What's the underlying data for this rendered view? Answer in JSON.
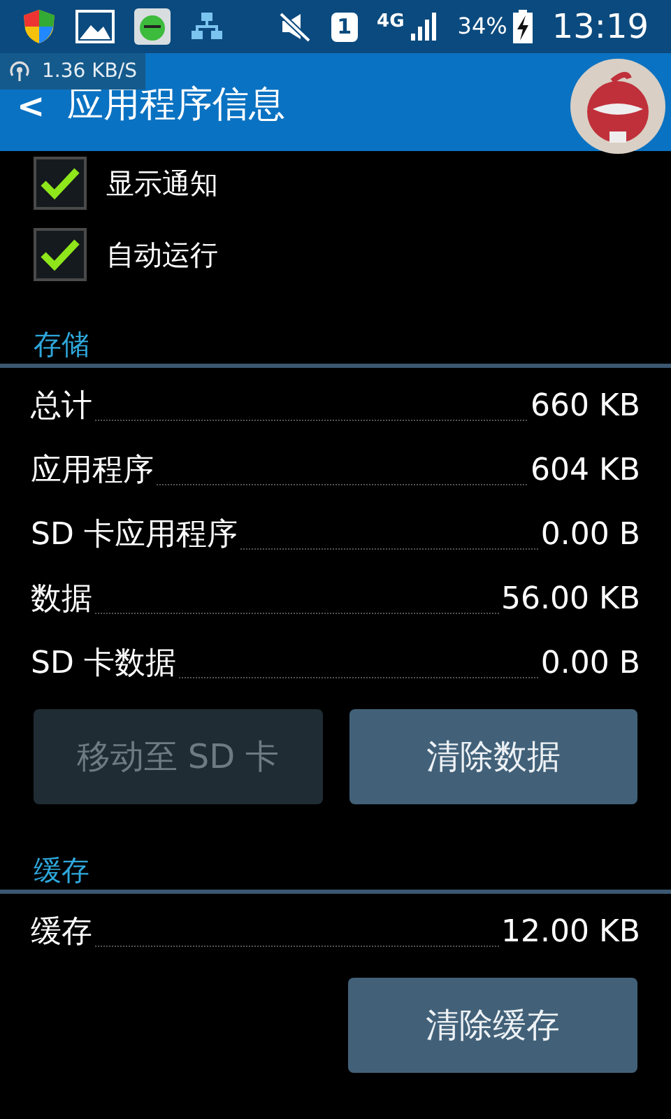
{
  "status_bar": {
    "sim": "1",
    "network": "4G",
    "battery": "34%",
    "time": "13:19"
  },
  "speed_overlay": "1.36 KB/S",
  "app_bar": {
    "back": "<",
    "title": "应用程序信息"
  },
  "options": [
    {
      "label": "显示通知",
      "checked": true
    },
    {
      "label": "自动运行",
      "checked": true
    }
  ],
  "sections": [
    {
      "title": "存储",
      "rows": [
        {
          "label": "总计",
          "value": "660 KB"
        },
        {
          "label": "应用程序",
          "value": "604 KB"
        },
        {
          "label": "SD 卡应用程序",
          "value": "0.00 B"
        },
        {
          "label": "数据",
          "value": "56.00 KB"
        },
        {
          "label": "SD 卡数据",
          "value": "0.00 B"
        }
      ],
      "buttons": [
        {
          "label": "移动至 SD 卡",
          "disabled": true
        },
        {
          "label": "清除数据",
          "disabled": false
        }
      ]
    },
    {
      "title": "缓存",
      "rows": [
        {
          "label": "缓存",
          "value": "12.00 KB"
        }
      ],
      "buttons": [
        {
          "label": "清除缓存",
          "disabled": false
        }
      ]
    }
  ]
}
